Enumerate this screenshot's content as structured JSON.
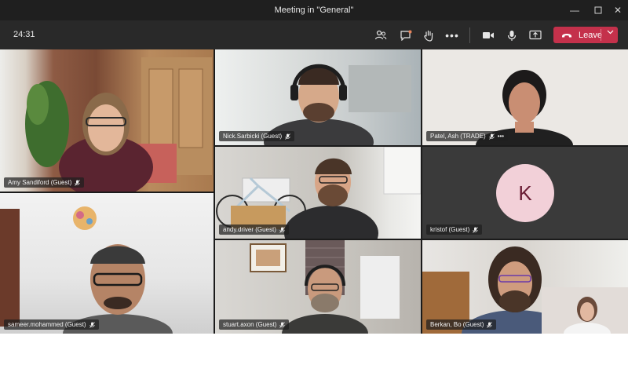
{
  "window": {
    "title": "Meeting in \"General\""
  },
  "toolbar": {
    "timer": "24:31",
    "buttons": [
      "people-icon",
      "chat-icon",
      "raise-hand-icon",
      "more-icon",
      "camera-icon",
      "microphone-icon",
      "share-icon"
    ],
    "leave_label": "Leave"
  },
  "participants": [
    {
      "name": "Amy Sandiford (Guest)"
    },
    {
      "name": "Nick.Sarbicki (Guest)"
    },
    {
      "name": "Patel, Ash (TRADE)",
      "more": "•••"
    },
    {
      "name": "andy.driver (Guest)"
    },
    {
      "name": "kristof (Guest)",
      "avatar_initial": "K"
    },
    {
      "name": "sameer.mohammed (Guest)"
    },
    {
      "name": "stuart.axon (Guest)"
    },
    {
      "name": "Berkan, Bo (Guest)"
    }
  ],
  "colors": {
    "leave": "#c4314b",
    "titlebar": "#1f1f1f",
    "toolbar": "#292929",
    "avatar_bg": "#f2d0d8",
    "avatar_text": "#6b1d35"
  }
}
